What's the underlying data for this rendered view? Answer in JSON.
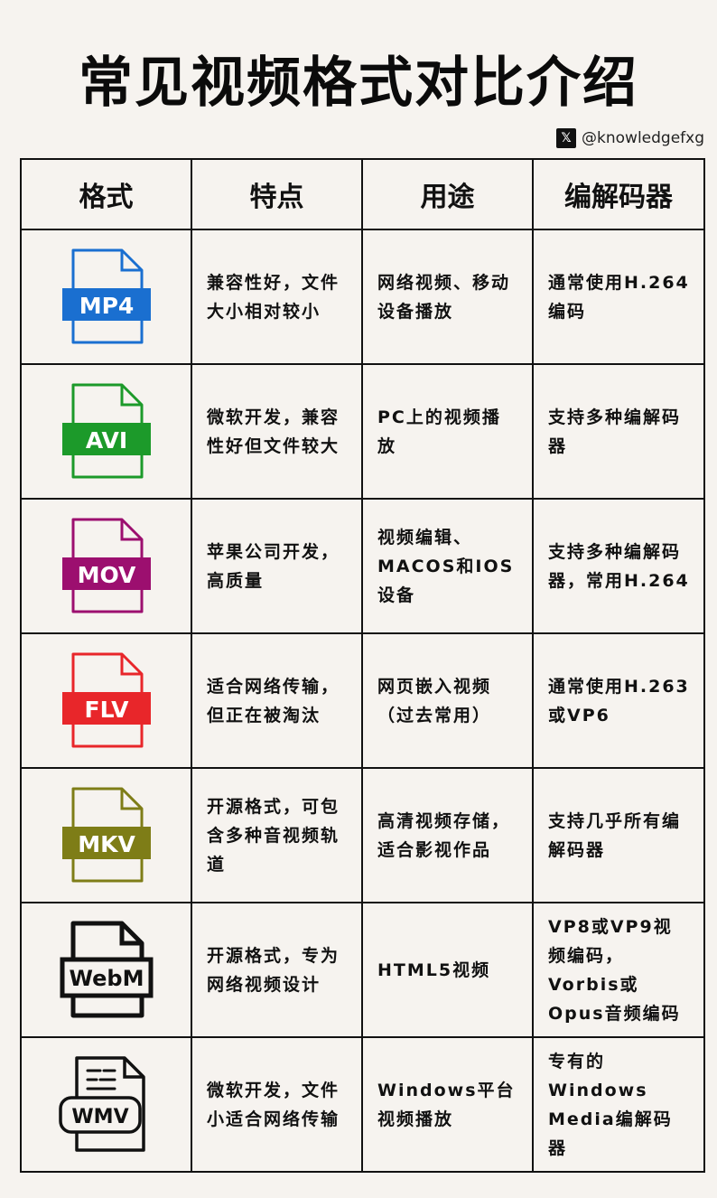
{
  "title": "常见视频格式对比介绍",
  "handle": {
    "icon": "x-logo-icon",
    "text": "@knowledgefxg"
  },
  "headers": {
    "format": "格式",
    "features": "特点",
    "usage": "用途",
    "codec": "编解码器"
  },
  "rows": [
    {
      "label": "MP4",
      "color": "#1a6fd0",
      "icon": "mp4-file-icon",
      "features": "兼容性好，文件大小相对较小",
      "usage": "网络视频、移动设备播放",
      "codec": "通常使用H.264编码"
    },
    {
      "label": "AVI",
      "color": "#1c9a2a",
      "icon": "avi-file-icon",
      "features": "微软开发，兼容性好但文件较大",
      "usage": "PC上的视频播放",
      "codec": "支持多种编解码器"
    },
    {
      "label": "MOV",
      "color": "#9c0f6f",
      "icon": "mov-file-icon",
      "features": "苹果公司开发，高质量",
      "usage": "视频编辑、MACOS和IOS设备",
      "codec": "支持多种编解码器，常用H.264"
    },
    {
      "label": "FLV",
      "color": "#e8262a",
      "icon": "flv-file-icon",
      "features": "适合网络传输，但正在被淘汰",
      "usage": "网页嵌入视频（过去常用）",
      "codec": "通常使用H.263或VP6"
    },
    {
      "label": "MKV",
      "color": "#7e7d17",
      "icon": "mkv-file-icon",
      "features": "开源格式，可包含多种音视频轨道",
      "usage": "高清视频存储，适合影视作品",
      "codec": "支持几乎所有编解码器"
    },
    {
      "label": "WebM",
      "color": "#111111",
      "icon": "webm-file-icon",
      "features": "开源格式，专为网络视频设计",
      "usage": "HTML5视频",
      "codec": "VP8或VP9视频编码，Vorbis或Opus音频编码"
    },
    {
      "label": "WMV",
      "color": "#111111",
      "icon": "wmv-file-icon",
      "features": "微软开发，文件小适合网络传输",
      "usage": "Windows平台视频播放",
      "codec": "专有的Windows Media编解码器"
    }
  ]
}
